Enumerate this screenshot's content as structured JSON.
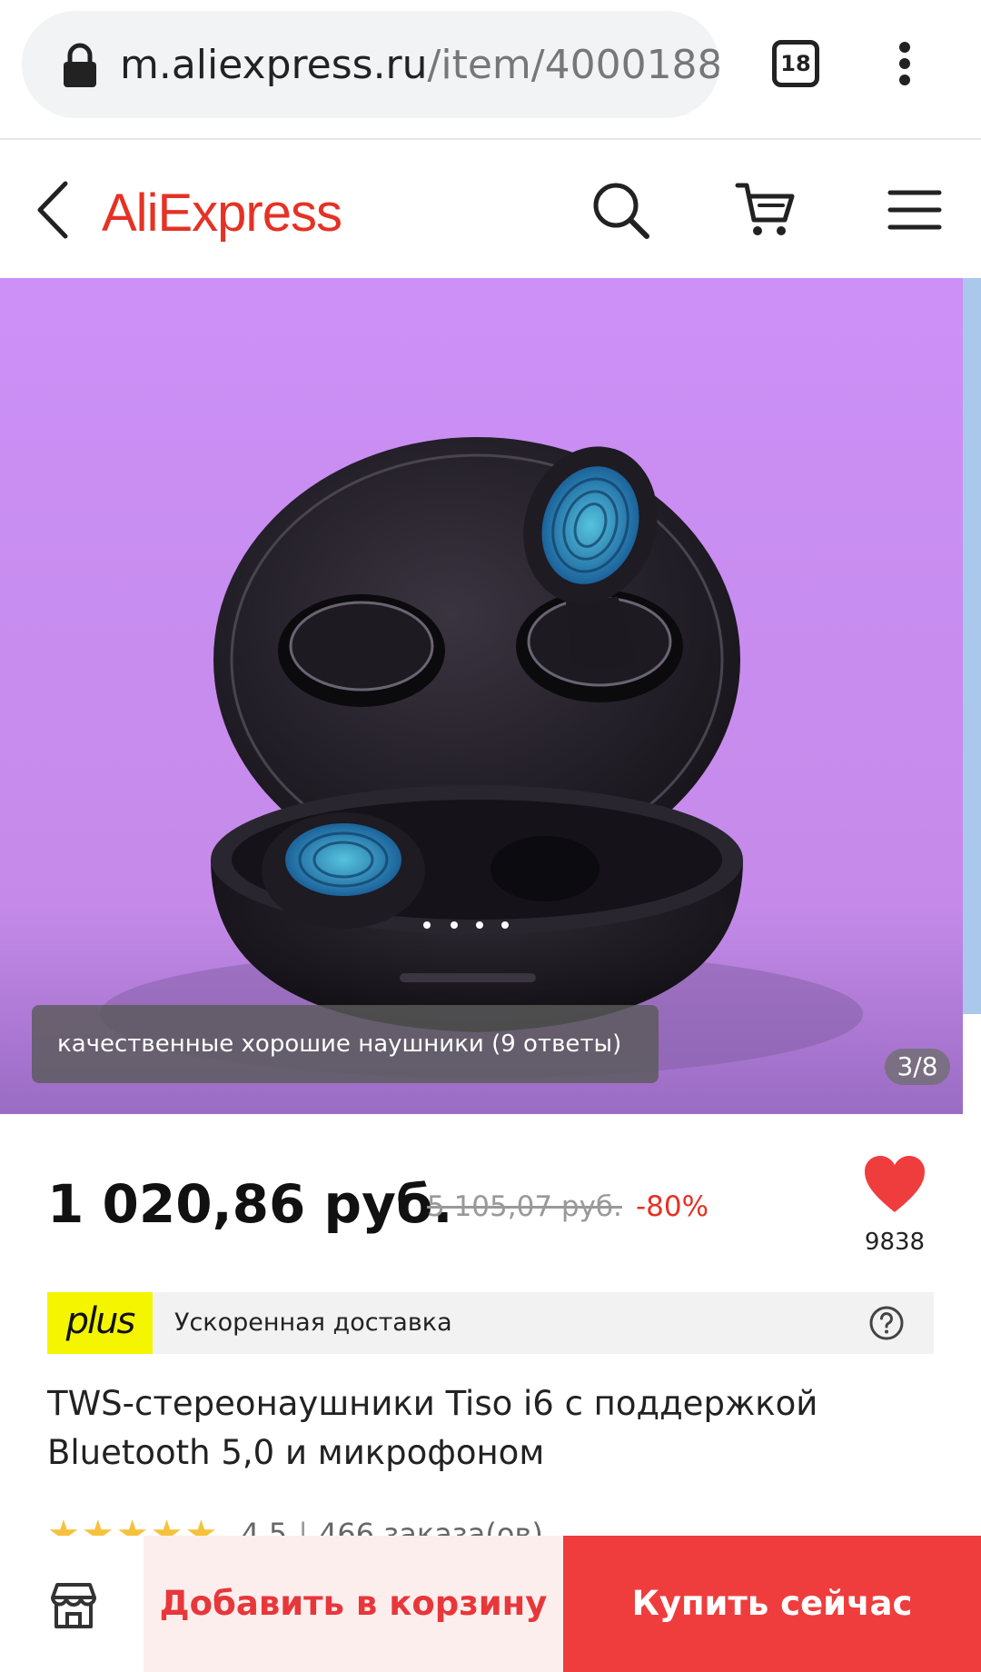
{
  "browser": {
    "url_host": "m.aliexpress.ru",
    "url_path": "/item/4000188",
    "tab_count": "18",
    "icons": {
      "lock": "lock-icon",
      "tabs": "tab-switcher-icon",
      "menu": "kebab-menu-icon"
    }
  },
  "header": {
    "logo_text": "AliExpress",
    "icons": {
      "back": "back-arrow-icon",
      "search": "search-icon",
      "cart": "cart-icon",
      "menu": "hamburger-menu-icon"
    },
    "brand_color": "#e43225"
  },
  "gallery": {
    "caption": "качественные хорошие наушники (9 ответы)",
    "counter": "3/8",
    "background_color": "#c88cf2"
  },
  "product": {
    "price": "1 020,86 руб.",
    "old_price": "5 105,07 руб.",
    "discount": "-80%",
    "wishlist_count": "9838",
    "plus_badge": "plus",
    "delivery_text": "Ускоренная доставка",
    "title": "TWS-стереонаушники Tiso i6 с поддержкой Bluetooth 5,0 и микрофоном",
    "rating_value": "4,5",
    "orders": "466 заказа(ов)",
    "rating_stars": 4.5
  },
  "actions": {
    "add_to_cart": "Добавить в корзину",
    "buy_now": "Купить сейчас",
    "store_icon": "store-icon",
    "accent": "#ef3d3d"
  }
}
